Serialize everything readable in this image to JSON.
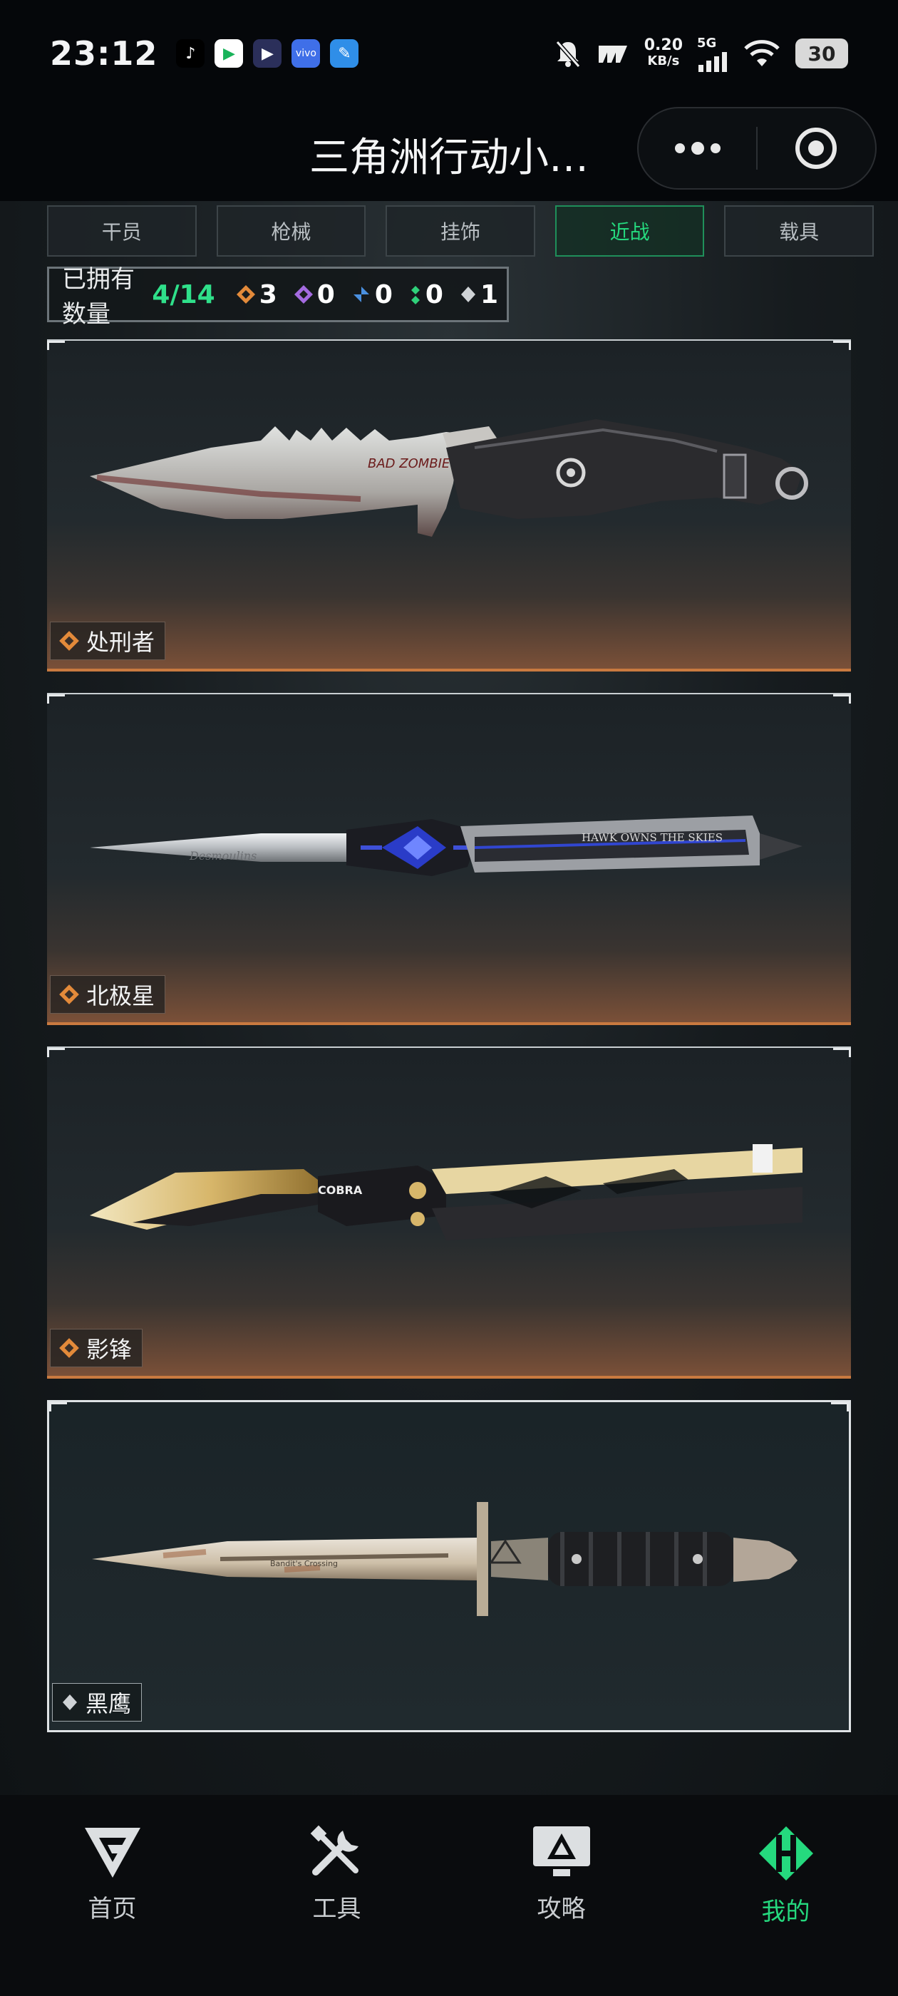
{
  "status_bar": {
    "time": "23:12",
    "net_speed_value": "0.20",
    "net_speed_unit": "KB/s",
    "network": "5G",
    "battery": "30"
  },
  "title_bar": {
    "title": "三角洲行动小…",
    "more_icon": "more-dots-icon",
    "close_icon": "target-close-icon"
  },
  "tabs": [
    {
      "label": "干员",
      "active": false
    },
    {
      "label": "枪械",
      "active": false
    },
    {
      "label": "挂饰",
      "active": false
    },
    {
      "label": "近战",
      "active": true
    },
    {
      "label": "载具",
      "active": false
    }
  ],
  "owned": {
    "label": "已拥有数量",
    "count": "4/14",
    "rarities": [
      {
        "color": "#e38a3a",
        "count": "3"
      },
      {
        "color": "#a46be0",
        "count": "0"
      },
      {
        "color": "#4a90e0",
        "count": "0"
      },
      {
        "color": "#2fd07a",
        "count": "0"
      },
      {
        "color": "#cfd3d6",
        "count": "1"
      }
    ]
  },
  "cards": [
    {
      "name": "处刑者",
      "rarity": "gold",
      "weapon": "serrated-knife",
      "engraving": "BAD ZOMBIE"
    },
    {
      "name": "北极星",
      "rarity": "gold",
      "weapon": "dagger",
      "engraving": "Desmoulins",
      "engraving2": "HAWK OWNS THE SKIES"
    },
    {
      "name": "影锋",
      "rarity": "gold",
      "weapon": "butterfly-knife",
      "engraving": "COBRA"
    },
    {
      "name": "黑鹰",
      "rarity": "white",
      "weapon": "bayonet",
      "engraving": "Bandit's Crossing"
    }
  ],
  "bottom_nav": [
    {
      "label": "首页",
      "icon": "home-logo-icon",
      "active": false
    },
    {
      "label": "工具",
      "icon": "tools-icon",
      "active": false
    },
    {
      "label": "攻略",
      "icon": "guide-monitor-icon",
      "active": false
    },
    {
      "label": "我的",
      "icon": "profile-logo-icon",
      "active": true
    }
  ],
  "colors": {
    "accent_green": "#25d97e",
    "gold_rarity": "#e38a3a",
    "white_rarity": "#cfd3d6"
  }
}
